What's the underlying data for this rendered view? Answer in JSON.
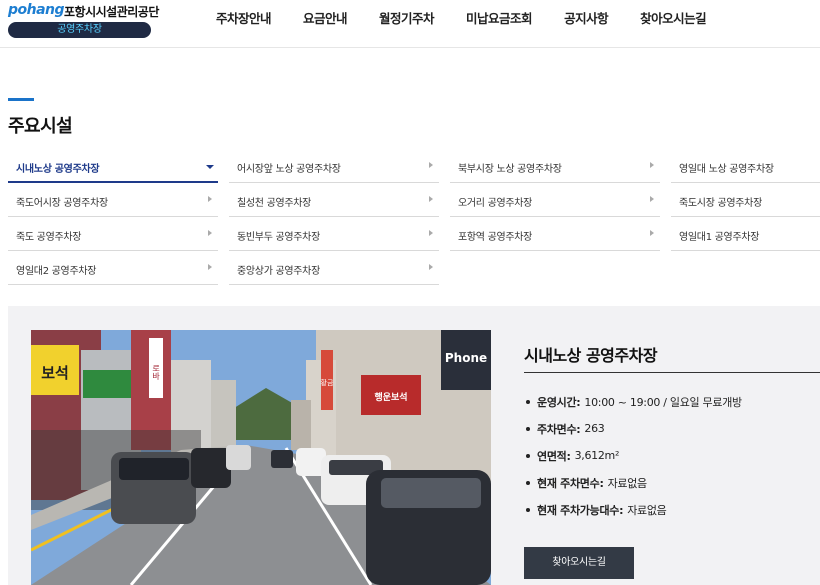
{
  "header": {
    "logo_brand": "pohang",
    "logo_org": "포항시시설관리공단",
    "logo_badge": "공영주차장",
    "nav": [
      "주차장안내",
      "요금안내",
      "월정기주차",
      "미납요금조회",
      "공지사항",
      "찾아오시는길"
    ]
  },
  "page_title": "주요시설",
  "facilities": [
    {
      "label": "시내노상 공영주차장",
      "active": true
    },
    {
      "label": "어시장앞 노상 공영주차장",
      "active": false
    },
    {
      "label": "북부시장 노상 공영주차장",
      "active": false
    },
    {
      "label": "영일대 노상 공영주차장",
      "active": false
    },
    {
      "label": "죽도어시장 공영주차장",
      "active": false
    },
    {
      "label": "칠성천 공영주차장",
      "active": false
    },
    {
      "label": "오거리 공영주차장",
      "active": false
    },
    {
      "label": "죽도시장 공영주차장",
      "active": false
    },
    {
      "label": "죽도 공영주차장",
      "active": false
    },
    {
      "label": "동빈부두 공영주차장",
      "active": false
    },
    {
      "label": "포항역 공영주차장",
      "active": false
    },
    {
      "label": "영일대1 공영주차장",
      "active": false
    },
    {
      "label": "영일대2 공영주차장",
      "active": false
    },
    {
      "label": "중앙상가 공영주차장",
      "active": false
    }
  ],
  "detail": {
    "title": "시내노상 공영주차장",
    "info": [
      {
        "label": "운영시간:",
        "value": "10:00 ~ 19:00 / 일요일 무료개방"
      },
      {
        "label": "주차면수:",
        "value": "263"
      },
      {
        "label": "연면적:",
        "value": "3,612m²"
      },
      {
        "label": "현재 주차면수:",
        "value": "자료없음"
      },
      {
        "label": "현재 주차가능대수:",
        "value": "자료없음"
      }
    ],
    "button_label": "찾아오시는길",
    "photo_signs": [
      "보석",
      "로바",
      "Phone",
      "행운보석",
      "황금"
    ]
  },
  "colors": {
    "accent_blue": "#1a73c9",
    "active_navy": "#1e3a8a",
    "badge_bg": "#1f2a44",
    "badge_text": "#57d1ff",
    "button_bg": "#333a45",
    "panel_bg": "#f2f2f4"
  }
}
